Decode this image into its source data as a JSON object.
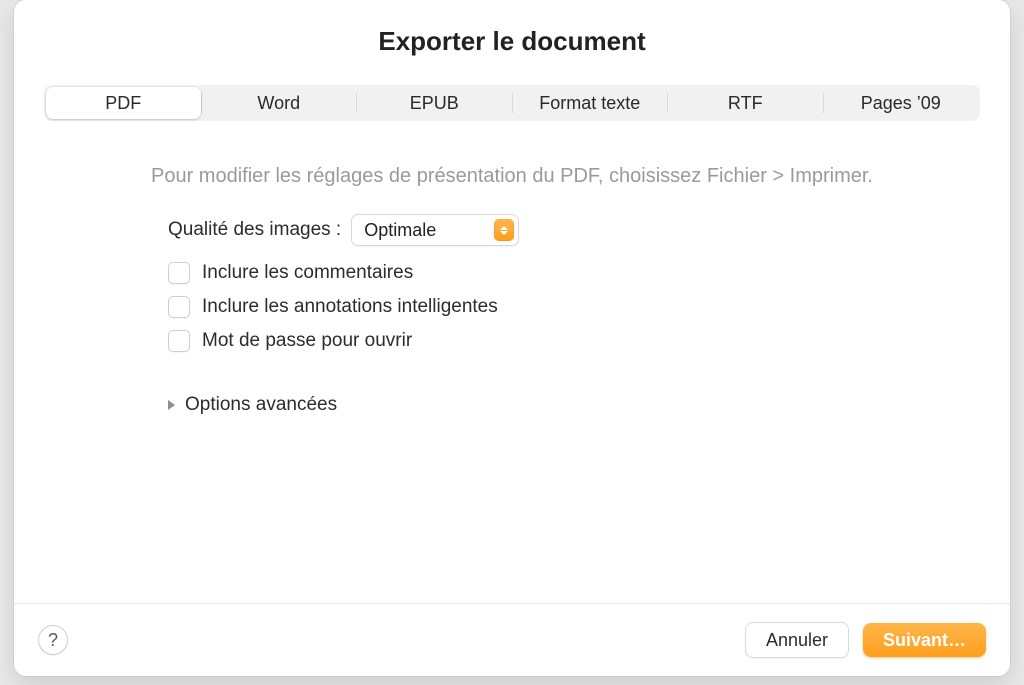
{
  "title": "Exporter le document",
  "tabs": {
    "pdf": "PDF",
    "word": "Word",
    "epub": "EPUB",
    "text": "Format texte",
    "rtf": "RTF",
    "pages09": "Pages ’09",
    "active": "pdf"
  },
  "hint": "Pour modifier les réglages de présentation du PDF, choisissez Fichier > Imprimer.",
  "image_quality": {
    "label": "Qualité des images :",
    "value": "Optimale"
  },
  "checks": {
    "comments": "Inclure les commentaires",
    "smart_annotations": "Inclure les annotations intelligentes",
    "password": "Mot de passe pour ouvrir"
  },
  "advanced": "Options avancées",
  "footer": {
    "help": "?",
    "cancel": "Annuler",
    "next": "Suivant…"
  }
}
